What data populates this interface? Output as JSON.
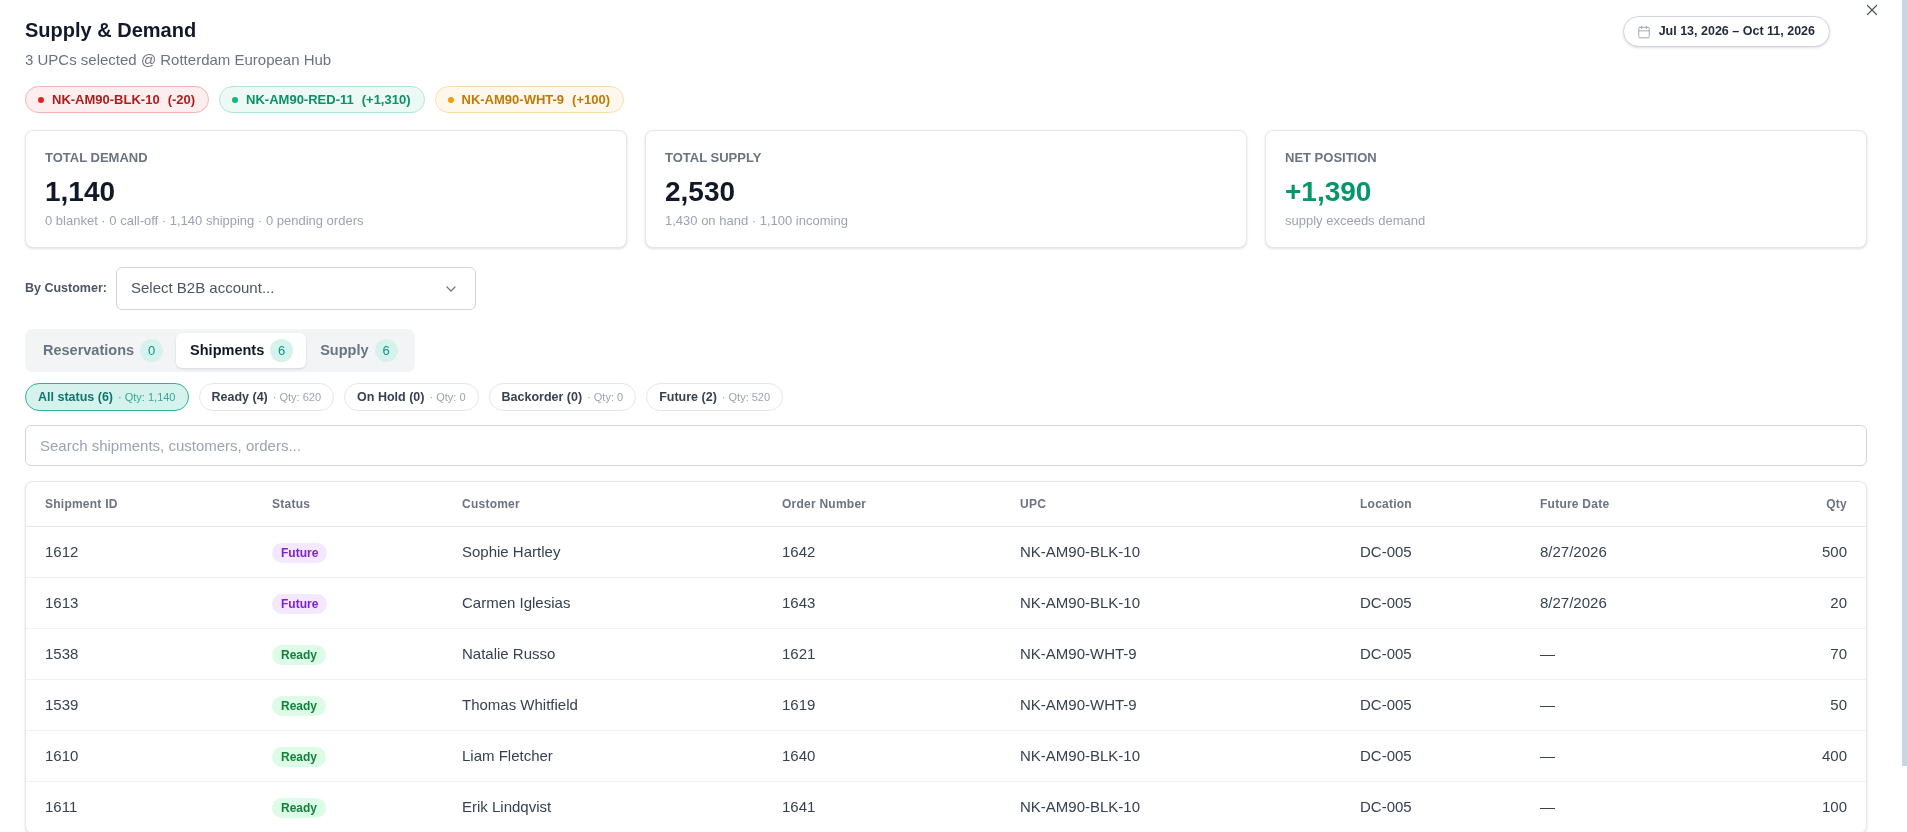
{
  "header": {
    "title": "Supply & Demand",
    "subtitle": "3 UPCs selected @ Rotterdam European Hub",
    "date_range": "Jul 13, 2026 – Oct 11, 2026"
  },
  "upc_chips": [
    {
      "upc": "NK-AM90-BLK-10",
      "delta": "(-20)",
      "color": "#dc2626"
    },
    {
      "upc": "NK-AM90-RED-11",
      "delta": "(+1,310)",
      "color": "#10b981"
    },
    {
      "upc": "NK-AM90-WHT-9",
      "delta": "(+100)",
      "color": "#f59e0b"
    }
  ],
  "metrics": [
    {
      "label": "TOTAL DEMAND",
      "value": "1,140",
      "detail": "0 blanket · 0 call-off · 1,140 shipping · 0 pending orders",
      "color": "#111827"
    },
    {
      "label": "TOTAL SUPPLY",
      "value": "2,530",
      "detail": "1,430 on hand · 1,100 incoming",
      "color": "#111827"
    },
    {
      "label": "NET POSITION",
      "value": "+1,390",
      "detail": "supply exceeds demand",
      "color": "#059669"
    }
  ],
  "customer_filter": {
    "label": "By Customer:",
    "placeholder": "Select B2B account..."
  },
  "tabs": [
    {
      "label": "Reservations",
      "count": "0",
      "selected": false
    },
    {
      "label": "Shipments",
      "count": "6",
      "selected": true
    },
    {
      "label": "Supply",
      "count": "6",
      "selected": false
    }
  ],
  "status_filters": [
    {
      "label": "All status (6)",
      "qty": "· Qty: 1,140",
      "selected": true
    },
    {
      "label": "Ready (4)",
      "qty": "· Qty: 620",
      "selected": false
    },
    {
      "label": "On Hold (0)",
      "qty": "· Qty: 0",
      "selected": false
    },
    {
      "label": "Backorder (0)",
      "qty": "· Qty: 0",
      "selected": false
    },
    {
      "label": "Future (2)",
      "qty": "· Qty: 520",
      "selected": false
    }
  ],
  "search": {
    "placeholder": "Search shipments, customers, orders..."
  },
  "table": {
    "columns": [
      "Shipment ID",
      "Status",
      "Customer",
      "Order Number",
      "UPC",
      "Location",
      "Future Date",
      "Qty"
    ],
    "rows": [
      {
        "shipment_id": "1612",
        "status": {
          "label": "Future",
          "kind": "future"
        },
        "customer": "Sophie Hartley",
        "order_number": "1642",
        "upc": "NK-AM90-BLK-10",
        "location": "DC-005",
        "future_date": "8/27/2026",
        "qty": "500"
      },
      {
        "shipment_id": "1613",
        "status": {
          "label": "Future",
          "kind": "future"
        },
        "customer": "Carmen Iglesias",
        "order_number": "1643",
        "upc": "NK-AM90-BLK-10",
        "location": "DC-005",
        "future_date": "8/27/2026",
        "qty": "20"
      },
      {
        "shipment_id": "1538",
        "status": {
          "label": "Ready",
          "kind": "ready"
        },
        "customer": "Natalie Russo",
        "order_number": "1621",
        "upc": "NK-AM90-WHT-9",
        "location": "DC-005",
        "future_date": "—",
        "qty": "70"
      },
      {
        "shipment_id": "1539",
        "status": {
          "label": "Ready",
          "kind": "ready"
        },
        "customer": "Thomas Whitfield",
        "order_number": "1619",
        "upc": "NK-AM90-WHT-9",
        "location": "DC-005",
        "future_date": "—",
        "qty": "50"
      },
      {
        "shipment_id": "1610",
        "status": {
          "label": "Ready",
          "kind": "ready"
        },
        "customer": "Liam Fletcher",
        "order_number": "1640",
        "upc": "NK-AM90-BLK-10",
        "location": "DC-005",
        "future_date": "—",
        "qty": "400"
      },
      {
        "shipment_id": "1611",
        "status": {
          "label": "Ready",
          "kind": "ready"
        },
        "customer": "Erik Lindqvist",
        "order_number": "1641",
        "upc": "NK-AM90-BLK-10",
        "location": "DC-005",
        "future_date": "—",
        "qty": "100"
      }
    ]
  }
}
